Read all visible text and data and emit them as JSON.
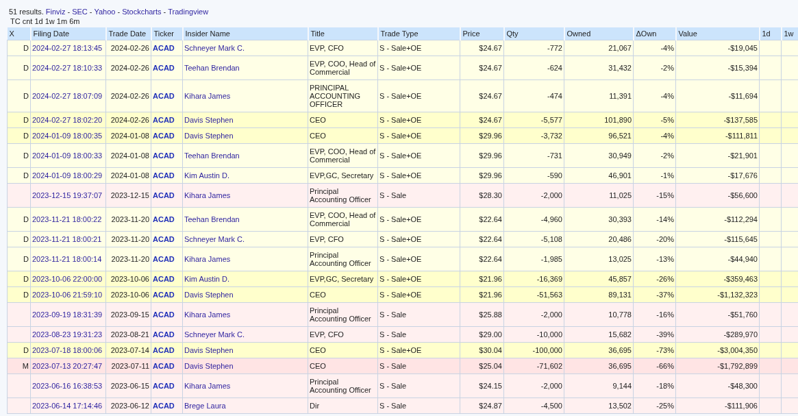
{
  "links_line": [
    {
      "kind": "text",
      "text": "51 results."
    },
    {
      "kind": "link",
      "text": "Finviz"
    },
    {
      "kind": "text",
      "text": "-"
    },
    {
      "kind": "link",
      "text": "SEC"
    },
    {
      "kind": "text",
      "text": "-"
    },
    {
      "kind": "link",
      "text": "Yahoo"
    },
    {
      "kind": "text",
      "text": "-"
    },
    {
      "kind": "link",
      "text": "Stockcharts"
    },
    {
      "kind": "text",
      "text": "-"
    },
    {
      "kind": "link",
      "text": "Tradingview"
    }
  ],
  "subheader": "TC cnt 1d 1w 1m 6m",
  "table": {
    "columns": [
      "X",
      "Filing Date",
      "Trade Date",
      "Ticker",
      "Insider Name",
      "Title",
      "Trade Type",
      "Price",
      "Qty",
      "Owned",
      "ΔOwn",
      "Value",
      "1d",
      "1w"
    ],
    "rows": [
      {
        "x": "D",
        "filing_date": "2024-02-27 18:13:45",
        "trade_date": "2024-02-26",
        "ticker": "ACAD",
        "insider": "Schneyer Mark C.",
        "title": "EVP, CFO",
        "trade_type": "S - Sale+OE",
        "price": "$24.67",
        "qty": "-772",
        "owned": "21,067",
        "delta_own": "-4%",
        "value": "-$19,045",
        "color": "#ffffe6"
      },
      {
        "x": "D",
        "filing_date": "2024-02-27 18:10:33",
        "trade_date": "2024-02-26",
        "ticker": "ACAD",
        "insider": "Teehan Brendan",
        "title": "EVP, COO, Head of Commercial",
        "trade_type": "S - Sale+OE",
        "price": "$24.67",
        "qty": "-624",
        "owned": "31,432",
        "delta_own": "-2%",
        "value": "-$15,394",
        "color": "#ffffe6"
      },
      {
        "x": "D",
        "filing_date": "2024-02-27 18:07:09",
        "trade_date": "2024-02-26",
        "ticker": "ACAD",
        "insider": "Kihara James",
        "title": "PRINCIPAL ACCOUNTING OFFICER",
        "trade_type": "S - Sale+OE",
        "price": "$24.67",
        "qty": "-474",
        "owned": "11,391",
        "delta_own": "-4%",
        "value": "-$11,694",
        "color": "#ffffe6"
      },
      {
        "x": "D",
        "filing_date": "2024-02-27 18:02:20",
        "trade_date": "2024-02-26",
        "ticker": "ACAD",
        "insider": "Davis Stephen",
        "title": "CEO",
        "trade_type": "S - Sale+OE",
        "price": "$24.67",
        "qty": "-5,577",
        "owned": "101,890",
        "delta_own": "-5%",
        "value": "-$137,585",
        "color": "#ffffcc"
      },
      {
        "x": "D",
        "filing_date": "2024-01-09 18:00:35",
        "trade_date": "2024-01-08",
        "ticker": "ACAD",
        "insider": "Davis Stephen",
        "title": "CEO",
        "trade_type": "S - Sale+OE",
        "price": "$29.96",
        "qty": "-3,732",
        "owned": "96,521",
        "delta_own": "-4%",
        "value": "-$111,811",
        "color": "#ffffcc"
      },
      {
        "x": "D",
        "filing_date": "2024-01-09 18:00:33",
        "trade_date": "2024-01-08",
        "ticker": "ACAD",
        "insider": "Teehan Brendan",
        "title": "EVP, COO, Head of Commercial",
        "trade_type": "S - Sale+OE",
        "price": "$29.96",
        "qty": "-731",
        "owned": "30,949",
        "delta_own": "-2%",
        "value": "-$21,901",
        "color": "#ffffe6"
      },
      {
        "x": "D",
        "filing_date": "2024-01-09 18:00:29",
        "trade_date": "2024-01-08",
        "ticker": "ACAD",
        "insider": "Kim Austin D.",
        "title": "EVP,GC, Secretary",
        "trade_type": "S - Sale+OE",
        "price": "$29.96",
        "qty": "-590",
        "owned": "46,901",
        "delta_own": "-1%",
        "value": "-$17,676",
        "color": "#ffffe6"
      },
      {
        "filing_date": "2023-12-15 19:37:07",
        "trade_date": "2023-12-15",
        "ticker": "ACAD",
        "insider": "Kihara James",
        "title": "Principal Accounting Officer",
        "trade_type": "S - Sale",
        "price": "$28.30",
        "qty": "-2,000",
        "owned": "11,025",
        "delta_own": "-15%",
        "value": "-$56,600",
        "color": "#fff0f0"
      },
      {
        "x": "D",
        "filing_date": "2023-11-21 18:00:22",
        "trade_date": "2023-11-20",
        "ticker": "ACAD",
        "insider": "Teehan Brendan",
        "title": "EVP, COO, Head of Commercial",
        "trade_type": "S - Sale+OE",
        "price": "$22.64",
        "qty": "-4,960",
        "owned": "30,393",
        "delta_own": "-14%",
        "value": "-$112,294",
        "color": "#ffffe6"
      },
      {
        "x": "D",
        "filing_date": "2023-11-21 18:00:21",
        "trade_date": "2023-11-20",
        "ticker": "ACAD",
        "insider": "Schneyer Mark C.",
        "title": "EVP, CFO",
        "trade_type": "S - Sale+OE",
        "price": "$22.64",
        "qty": "-5,108",
        "owned": "20,486",
        "delta_own": "-20%",
        "value": "-$115,645",
        "color": "#ffffe6"
      },
      {
        "x": "D",
        "filing_date": "2023-11-21 18:00:14",
        "trade_date": "2023-11-20",
        "ticker": "ACAD",
        "insider": "Kihara James",
        "title": "Principal Accounting Officer",
        "trade_type": "S - Sale+OE",
        "price": "$22.64",
        "qty": "-1,985",
        "owned": "13,025",
        "delta_own": "-13%",
        "value": "-$44,940",
        "color": "#ffffe6"
      },
      {
        "x": "D",
        "filing_date": "2023-10-06 22:00:00",
        "trade_date": "2023-10-06",
        "ticker": "ACAD",
        "insider": "Kim Austin D.",
        "title": "EVP,GC, Secretary",
        "trade_type": "S - Sale+OE",
        "price": "$21.96",
        "qty": "-16,369",
        "owned": "45,857",
        "delta_own": "-26%",
        "value": "-$359,463",
        "color": "#ffffcc"
      },
      {
        "x": "D",
        "filing_date": "2023-10-06 21:59:10",
        "trade_date": "2023-10-06",
        "ticker": "ACAD",
        "insider": "Davis Stephen",
        "title": "CEO",
        "trade_type": "S - Sale+OE",
        "price": "$21.96",
        "qty": "-51,563",
        "owned": "89,131",
        "delta_own": "-37%",
        "value": "-$1,132,323",
        "color": "#ffffcc"
      },
      {
        "filing_date": "2023-09-19 18:31:39",
        "trade_date": "2023-09-15",
        "ticker": "ACAD",
        "insider": "Kihara James",
        "title": "Principal Accounting Officer",
        "trade_type": "S - Sale",
        "price": "$25.88",
        "qty": "-2,000",
        "owned": "10,778",
        "delta_own": "-16%",
        "value": "-$51,760",
        "color": "#fff0f0"
      },
      {
        "filing_date": "2023-08-23 19:31:23",
        "trade_date": "2023-08-21",
        "ticker": "ACAD",
        "insider": "Schneyer Mark C.",
        "title": "EVP, CFO",
        "trade_type": "S - Sale",
        "price": "$29.00",
        "qty": "-10,000",
        "owned": "15,682",
        "delta_own": "-39%",
        "value": "-$289,970",
        "color": "#fff0f0"
      },
      {
        "x": "D",
        "filing_date": "2023-07-18 18:00:06",
        "trade_date": "2023-07-14",
        "ticker": "ACAD",
        "insider": "Davis Stephen",
        "title": "CEO",
        "trade_type": "S - Sale+OE",
        "price": "$30.04",
        "qty": "-100,000",
        "owned": "36,695",
        "delta_own": "-73%",
        "value": "-$3,004,350",
        "color": "#ffffcc"
      },
      {
        "x": "M",
        "filing_date": "2023-07-13 20:27:47",
        "trade_date": "2023-07-11",
        "ticker": "ACAD",
        "insider": "Davis Stephen",
        "title": "CEO",
        "trade_type": "S - Sale",
        "price": "$25.04",
        "qty": "-71,602",
        "owned": "36,695",
        "delta_own": "-66%",
        "value": "-$1,792,899",
        "color": "#ffe4e4"
      },
      {
        "filing_date": "2023-06-16 16:38:53",
        "trade_date": "2023-06-15",
        "ticker": "ACAD",
        "insider": "Kihara James",
        "title": "Principal Accounting Officer",
        "trade_type": "S - Sale",
        "price": "$24.15",
        "qty": "-2,000",
        "owned": "9,144",
        "delta_own": "-18%",
        "value": "-$48,300",
        "color": "#fff0f0"
      },
      {
        "filing_date": "2023-06-14 17:14:46",
        "trade_date": "2023-06-12",
        "ticker": "ACAD",
        "insider": "Brege Laura",
        "title": "Dir",
        "trade_type": "S - Sale",
        "price": "$24.87",
        "qty": "-4,500",
        "owned": "13,502",
        "delta_own": "-25%",
        "value": "-$111,906",
        "color": "#fff0f0"
      }
    ]
  }
}
